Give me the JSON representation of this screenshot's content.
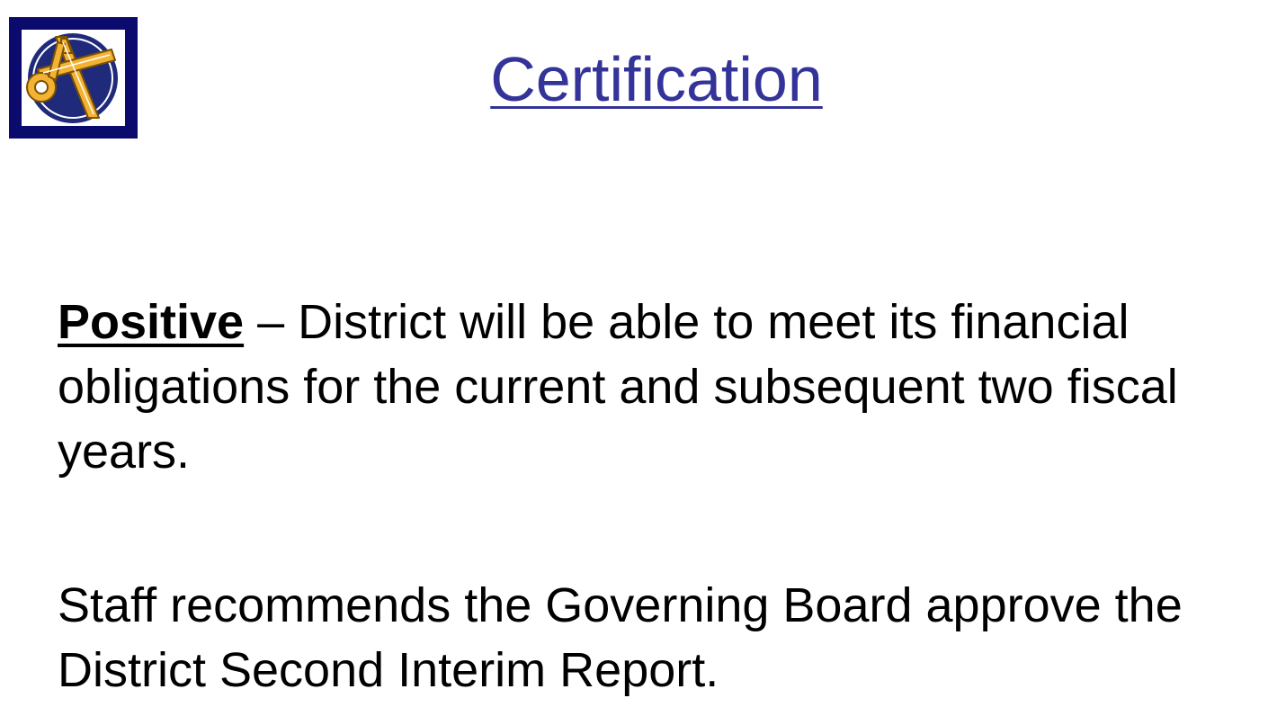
{
  "slide": {
    "title": "Certification",
    "logo_icon": "district-compass-logo-icon",
    "colors": {
      "title": "#333399",
      "logo_frame": "#0b0b6e",
      "logo_emblem": "#f4b234"
    },
    "paragraph_1": {
      "term": "Positive",
      "text": " – District will be able to meet its financial obligations for the current and subsequent two fiscal years."
    },
    "paragraph_2": {
      "text": "Staff recommends the Governing Board approve the District Second Interim Report."
    }
  }
}
